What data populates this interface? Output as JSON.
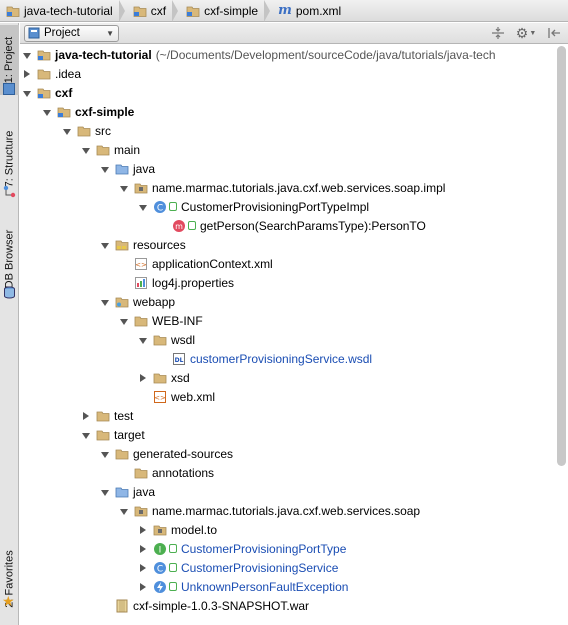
{
  "breadcrumbs": [
    {
      "label": "java-tech-tutorial",
      "icon": "module-folder-icon"
    },
    {
      "label": "cxf",
      "icon": "module-folder-icon"
    },
    {
      "label": "cxf-simple",
      "icon": "module-folder-icon"
    },
    {
      "label": "pom.xml",
      "icon": "maven-icon"
    }
  ],
  "stripe_tabs": {
    "project": "1: Project",
    "structure": "7: Structure",
    "db": "DB Browser",
    "favorites": "2: Favorites"
  },
  "toolbar": {
    "view_label": "Project",
    "collapse_icon": "collapse-all-icon",
    "settings_icon": "gear-icon",
    "hide_icon": "hide-panel-icon"
  },
  "tree": [
    {
      "label": "java-tech-tutorial",
      "path": "(~/Documents/Development/sourceCode/java/tutorials/java-tech",
      "icon": "module",
      "state": "down",
      "bold": true
    },
    {
      "label": ".idea",
      "icon": "folder",
      "state": "right"
    },
    {
      "label": "cxf",
      "icon": "module",
      "state": "down",
      "bold": true
    },
    {
      "label": "cxf-simple",
      "icon": "module",
      "state": "down",
      "bold": true
    },
    {
      "label": "src",
      "icon": "folder",
      "state": "down"
    },
    {
      "label": "main",
      "icon": "folder",
      "state": "down"
    },
    {
      "label": "java",
      "icon": "srcfolder",
      "state": "down"
    },
    {
      "label": "name.marmac.tutorials.java.cxf.web.services.soap.impl",
      "icon": "package",
      "state": "down"
    },
    {
      "label": "CustomerProvisioningPortTypeImpl",
      "icon": "class",
      "state": "down"
    },
    {
      "label": "getPerson(SearchParamsType):PersonTO",
      "icon": "method",
      "state": "none"
    },
    {
      "label": "resources",
      "icon": "resfolder",
      "state": "down"
    },
    {
      "label": "applicationContext.xml",
      "icon": "springxml",
      "state": "none"
    },
    {
      "label": "log4j.properties",
      "icon": "props",
      "state": "none"
    },
    {
      "label": "webapp",
      "icon": "webfolder",
      "state": "down"
    },
    {
      "label": "WEB-INF",
      "icon": "folder",
      "state": "down"
    },
    {
      "label": "wsdl",
      "icon": "folder",
      "state": "down"
    },
    {
      "label": "customerProvisioningService.wsdl",
      "icon": "wsdl",
      "state": "none",
      "blue": true
    },
    {
      "label": "xsd",
      "icon": "folder",
      "state": "right"
    },
    {
      "label": "web.xml",
      "icon": "xml",
      "state": "none"
    },
    {
      "label": "test",
      "icon": "folder",
      "state": "right"
    },
    {
      "label": "target",
      "icon": "folder",
      "state": "down"
    },
    {
      "label": "generated-sources",
      "icon": "folder",
      "state": "down"
    },
    {
      "label": "annotations",
      "icon": "folder",
      "state": "none"
    },
    {
      "label": "java",
      "icon": "srcfolder",
      "state": "down"
    },
    {
      "label": "name.marmac.tutorials.java.cxf.web.services.soap",
      "icon": "package",
      "state": "down"
    },
    {
      "label": "model.to",
      "icon": "package",
      "state": "right"
    },
    {
      "label": "CustomerProvisioningPortType",
      "icon": "interface",
      "state": "right",
      "blue": true
    },
    {
      "label": "CustomerProvisioningService",
      "icon": "class",
      "state": "right",
      "blue": true
    },
    {
      "label": "UnknownPersonFaultException",
      "icon": "exception",
      "state": "right",
      "blue": true
    },
    {
      "label": "cxf-simple-1.0.3-SNAPSHOT.war",
      "icon": "war",
      "state": "none"
    }
  ],
  "colors": {
    "folder": "#d8b87a",
    "class": "#4f8fdc",
    "interface": "#4caf50",
    "method": "#e24a5f",
    "accent_blue": "#1a4db3"
  }
}
